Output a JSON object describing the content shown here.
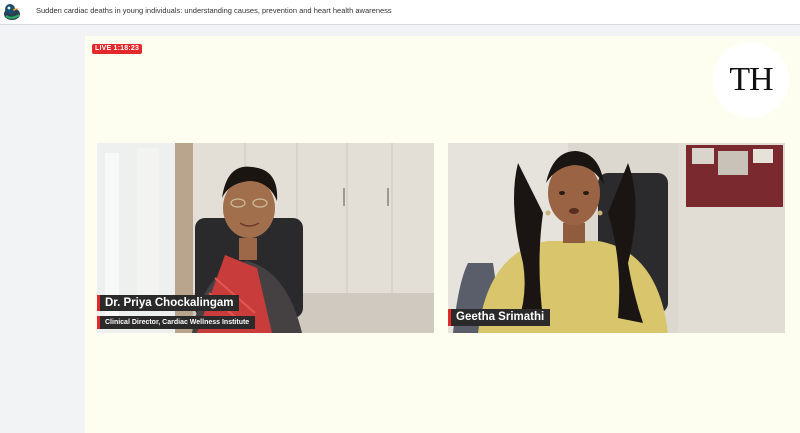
{
  "header": {
    "title": "Sudden cardiac deaths in young individuals: understanding causes, prevention and heart health awareness"
  },
  "stream": {
    "live_label": "LIVE 1:18:23",
    "logo_text": "TH"
  },
  "participants": [
    {
      "name": "Dr. Priya Chockalingam",
      "role": "Clinical Director, Cardiac Wellness Institute"
    },
    {
      "name": "Geetha Srimathi",
      "role": ""
    }
  ],
  "colors": {
    "accent": "#e5282a",
    "stage_bg": "#fdfdf0",
    "tag_bg": "#2a2a2a"
  },
  "icons": {
    "app_logo": "duck-logo-icon"
  }
}
